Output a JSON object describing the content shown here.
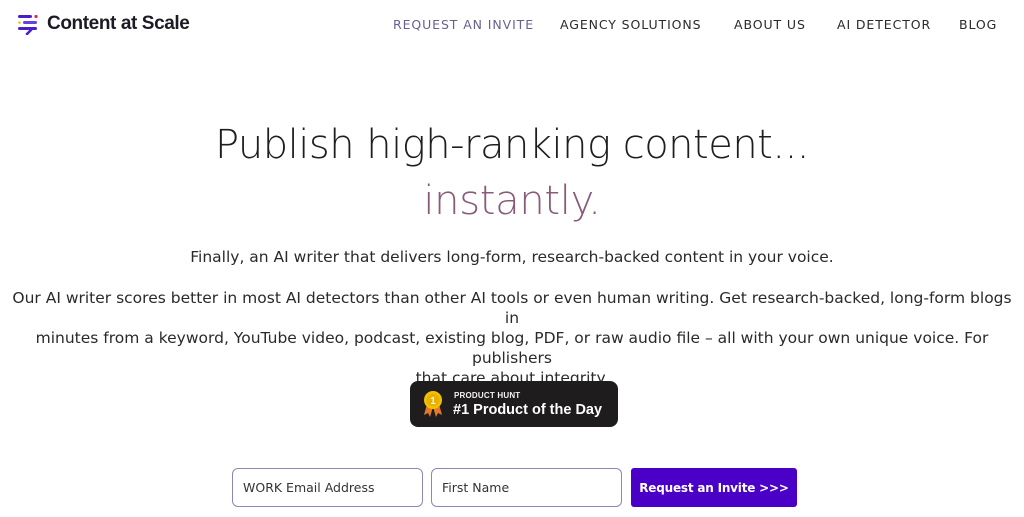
{
  "header": {
    "logo_text": "Content at Scale",
    "nav": [
      {
        "label": "REQUEST AN INVITE",
        "active": true
      },
      {
        "label": "AGENCY SOLUTIONS",
        "active": false
      },
      {
        "label": "ABOUT US",
        "active": false
      },
      {
        "label": "AI DETECTOR",
        "active": false
      },
      {
        "label": "BLOG",
        "active": false
      }
    ]
  },
  "hero": {
    "title": "Publish high-ranking content...",
    "accent": "instantly.",
    "subtitle": "Finally, an AI writer that delivers long-form, research-backed content in your voice.",
    "description_lines": [
      "Our AI writer scores better in most AI detectors than other AI tools or even human writing. Get research-backed, long-form blogs in",
      "minutes from a keyword, YouTube video, podcast, existing blog, PDF, or raw audio file – all with your own unique voice. For publishers",
      "that care about integrity."
    ]
  },
  "badge": {
    "small_label": "PRODUCT HUNT",
    "big_label": "#1 Product of the Day",
    "medal_number": "1"
  },
  "form": {
    "email_placeholder": "WORK Email Address",
    "name_placeholder": "First Name",
    "submit_label": "Request an Invite >>>"
  },
  "colors": {
    "brand_purple": "#4b00c8",
    "accent_mauve": "#8a5a7a",
    "nav_active": "#6a5f92"
  }
}
